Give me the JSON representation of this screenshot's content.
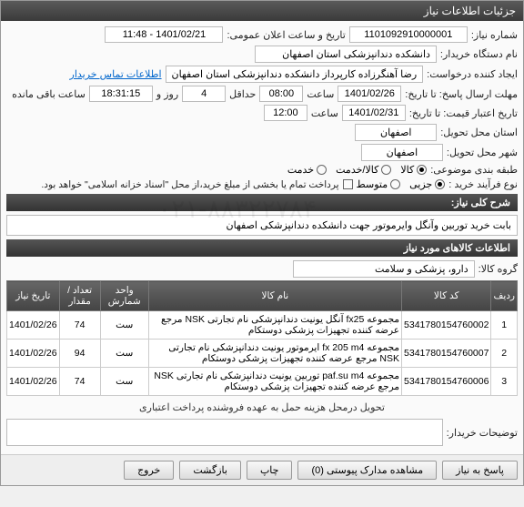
{
  "window": {
    "title": "جزئیات اطلاعات نیاز"
  },
  "fields": {
    "req_no_lbl": "شماره نیاز:",
    "req_no": "1101092910000001",
    "ann_dt_lbl": "تاریخ و ساعت اعلان عمومی:",
    "ann_dt": "1401/02/21 - 11:48",
    "buyer_lbl": "نام دستگاه خریدار:",
    "buyer": "دانشکده دندانپزشکی استان اصفهان",
    "creator_lbl": "ایجاد کننده درخواست:",
    "creator": "رضا آهنگرزاده کارپرداز دانشکده دندانپزشکی استان اصفهان",
    "contact_link": "اطلاعات تماس خریدار",
    "deadline_lbl": "مهلت ارسال پاسخ: تا تاریخ:",
    "deadline_date": "1401/02/26",
    "time_lbl": "ساعت",
    "deadline_time": "08:00",
    "deadline_days_lbl": "حداقل",
    "deadline_days": "4",
    "deadline_days_after": "روز و",
    "remaining": "18:31:15",
    "remaining_after": "ساعت باقی مانده",
    "valid_lbl": "تاریخ اعتبار قیمت: تا تاریخ:",
    "valid_date": "1401/02/31",
    "valid_time": "12:00",
    "loc_lbl": "استان محل تحویل:",
    "loc": "اصفهان",
    "city_lbl": "شهر محل تحویل:",
    "city": "اصفهان",
    "class_lbl": "طبقه بندی موضوعی:",
    "class_opts": [
      "کالا",
      "کالا/خدمت",
      "خدمت"
    ],
    "proc_lbl": "نوع فرآیند خرید :",
    "proc_opts": [
      "جزیی",
      "متوسط"
    ],
    "proc_note": "پرداخت تمام یا بخشی از مبلغ خرید،از محل \"اسناد خزانه اسلامی\" خواهد بود.",
    "desc_title_lbl": "شرح کلی نیاز:",
    "desc_title": "بابت خرید توربین وآنگل وایرموتور جهت دانشکده دندانپزشکی اصفهان",
    "items_bar": "اطلاعات کالاهای مورد نیاز",
    "group_lbl": "گروه کالا:",
    "group": "دارو، پزشکی و سلامت",
    "buyer_note_lbl": "توضیحات خریدار:",
    "buyer_note": "تحویل درمحل هزینه حمل به عهده فروشنده پرداخت اعتباری"
  },
  "table": {
    "headers": [
      "ردیف",
      "کد کالا",
      "نام کالا",
      "واحد شمارش",
      "تعداد / مقدار",
      "تاریخ نیاز"
    ],
    "rows": [
      {
        "n": "1",
        "code": "5341780154760002",
        "name": "مجموعه fx25 آنگل یونیت دندانپزشکی نام تجارتی NSK مرجع عرضه کننده تجهیزات پزشکی دوستکام",
        "unit": "ست",
        "qty": "74",
        "date": "1401/02/26"
      },
      {
        "n": "2",
        "code": "5341780154760007",
        "name": "مجموعه fx 205 m4 ایرموتور یونیت دندانپزشکی نام تجارتی NSK مرجع عرضه کننده تجهیزات پزشکی دوستکام",
        "unit": "ست",
        "qty": "94",
        "date": "1401/02/26"
      },
      {
        "n": "3",
        "code": "5341780154760006",
        "name": "مجموعه paf.su m4 توربین یونیت دندانپزشکی نام تجارتی NSK مرجع عرضه کننده تجهیزات پزشکی دوستکام",
        "unit": "ست",
        "qty": "74",
        "date": "1401/02/26"
      }
    ]
  },
  "buttons": {
    "reply": "پاسخ به نیاز",
    "attach": "مشاهده مدارک پیوستی (0)",
    "print": "چاپ",
    "back": "بازگشت",
    "exit": "خروج"
  }
}
